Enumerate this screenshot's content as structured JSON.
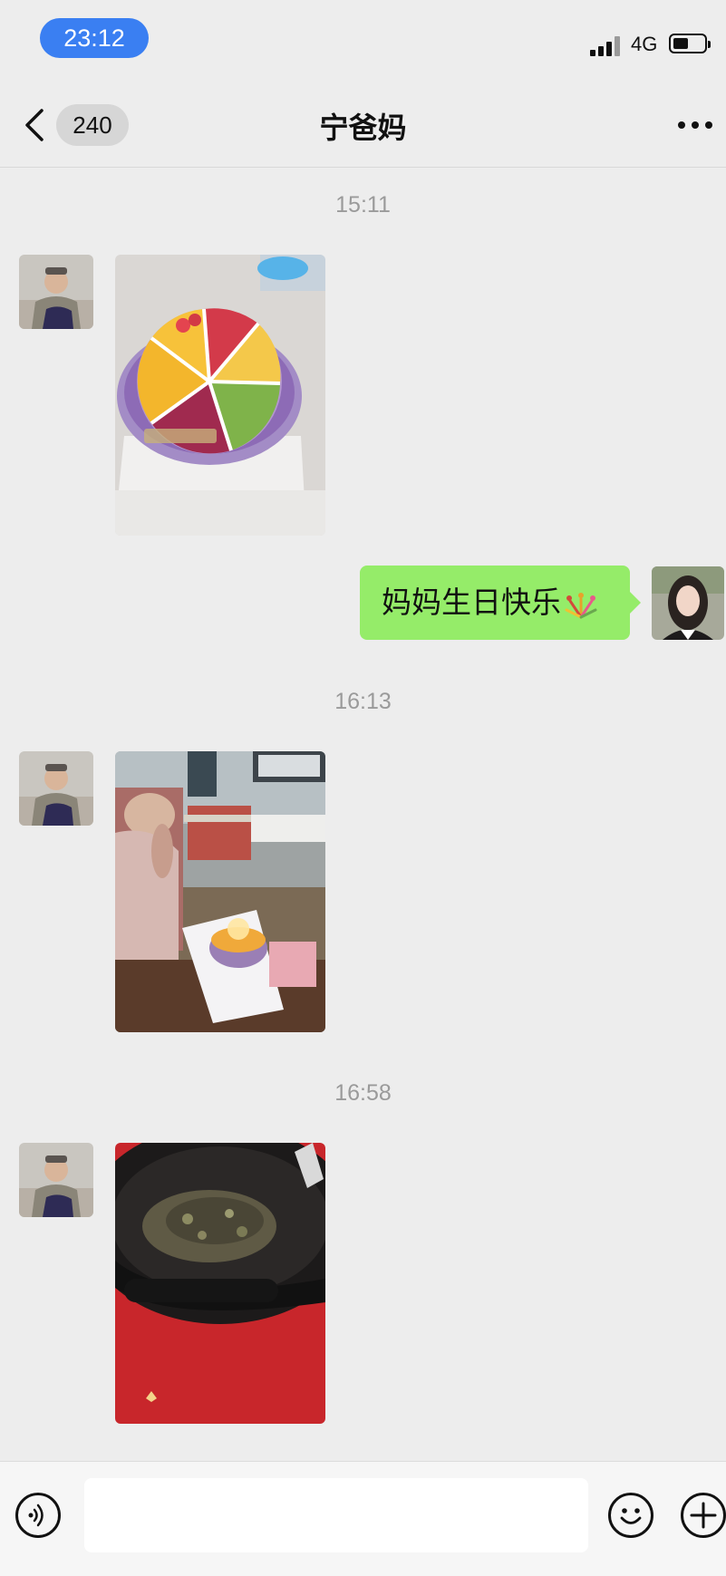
{
  "status_bar": {
    "time": "23:12",
    "network": "4G"
  },
  "nav": {
    "unread_count": "240",
    "title": "宁爸妈"
  },
  "messages": [
    {
      "type": "timestamp",
      "text": "15:11"
    },
    {
      "type": "image",
      "sender": "contact",
      "content": "fruit birthday cake photo"
    },
    {
      "type": "text",
      "sender": "me",
      "text": "妈妈生日快乐"
    },
    {
      "type": "timestamp",
      "text": "16:13"
    },
    {
      "type": "image",
      "sender": "contact",
      "content": "birthday candles photo"
    },
    {
      "type": "timestamp",
      "text": "16:58"
    },
    {
      "type": "image",
      "sender": "contact",
      "content": "cooked dish in wok photo"
    }
  ],
  "input_bar": {
    "placeholder": ""
  },
  "icons": {
    "back": "chevron-left-icon",
    "more": "more-dots-icon",
    "voice": "voice-icon",
    "emoji": "emoji-icon",
    "add": "plus-icon",
    "sent_emoji": "fireworks-icon"
  },
  "colors": {
    "background": "#ededed",
    "sent_bubble": "#95ec69",
    "time_pill": "#3a7ff2"
  }
}
